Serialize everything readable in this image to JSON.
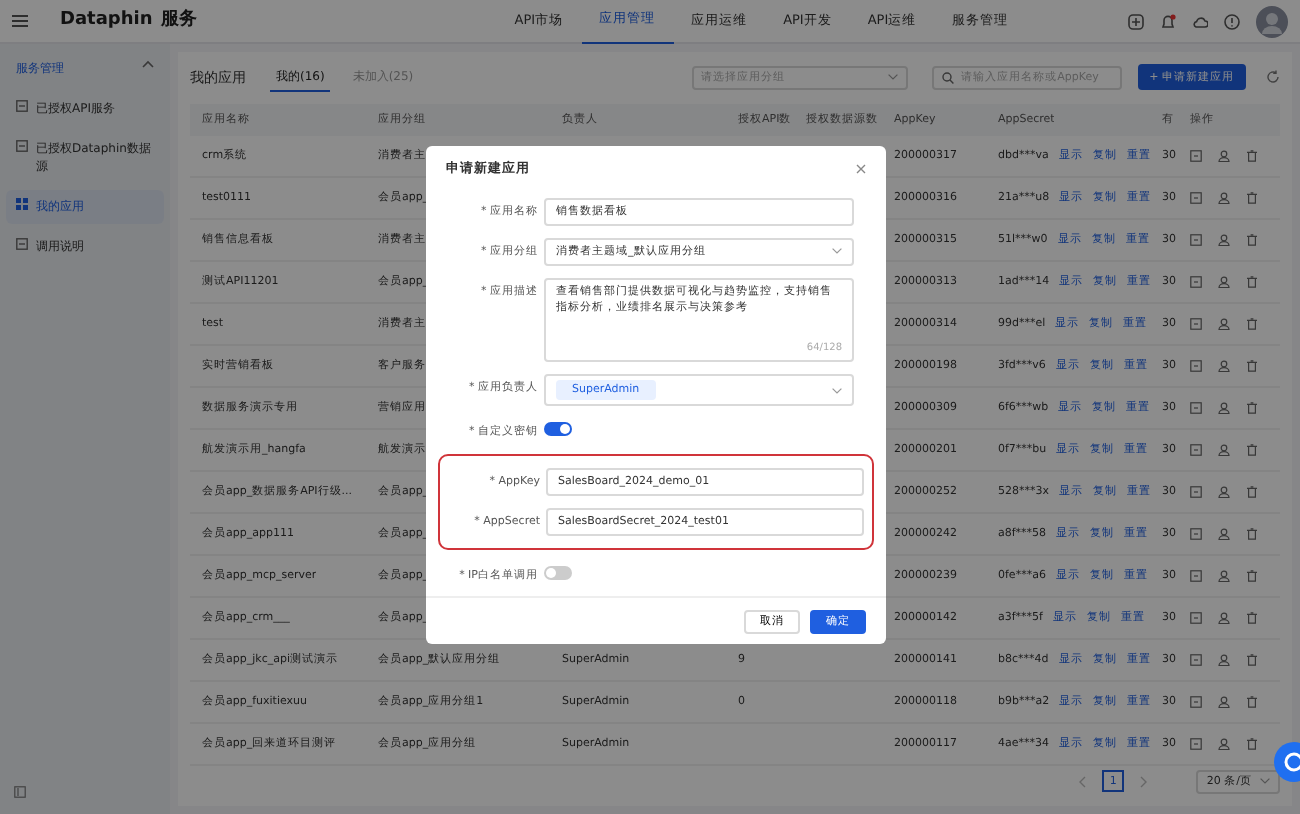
{
  "topbar": {
    "brand": "Dataphin",
    "product": "服务",
    "nav": [
      {
        "label": "API市场",
        "selected": false
      },
      {
        "label": "应用管理",
        "selected": true
      },
      {
        "label": "应用运维",
        "selected": false
      },
      {
        "label": "API开发",
        "selected": false
      },
      {
        "label": "API运维",
        "selected": false
      },
      {
        "label": "服务管理",
        "selected": false
      }
    ]
  },
  "sidebar": {
    "section": "服务管理",
    "expanded": true,
    "items": [
      {
        "label": "已授权API服务",
        "selected": false
      },
      {
        "label": "已授权Dataphin数据源",
        "selected": false
      },
      {
        "label": "我的应用",
        "selected": true
      },
      {
        "label": "调用说明",
        "selected": false
      }
    ]
  },
  "header": {
    "title": "我的应用",
    "tabs": [
      {
        "label": "我的(16)",
        "selected": true
      },
      {
        "label": "未加入(25)",
        "selected": false
      }
    ],
    "group_select": {
      "placeholder": "请选择应用分组"
    },
    "search": {
      "placeholder": "请输入应用名称或AppKey"
    },
    "create_button": "+ 申请新建应用"
  },
  "table": {
    "columns": [
      "应用名称",
      "应用分组",
      "负责人",
      "授权API数",
      "授权数据源数",
      "AppKey",
      "AppSecret",
      "有",
      "操作"
    ],
    "rows": [
      {
        "name": "crm系统",
        "group": "消费者主",
        "appkey": "200000317",
        "appsecret": "dbd***va",
        "column_8": "30",
        "links": [
          "显示",
          "复制",
          "重置"
        ]
      },
      {
        "name": "test0111",
        "group": "会员app_",
        "appkey": "200000316",
        "appsecret": "21a***u8",
        "column_8": "30",
        "links": [
          "显示",
          "复制",
          "重置"
        ]
      },
      {
        "name": "销售信息看板",
        "group": "消费者主",
        "appkey": "200000315",
        "appsecret": "51l***w0",
        "column_8": "30",
        "links": [
          "显示",
          "复制",
          "重置"
        ]
      },
      {
        "name": "测试API11201",
        "group": "会员app_",
        "appkey": "200000313",
        "appsecret": "1ad***14",
        "column_8": "30",
        "links": [
          "显示",
          "复制",
          "重置"
        ]
      },
      {
        "name": "test",
        "group": "消费者主",
        "appkey": "200000314",
        "appsecret": "99d***el",
        "column_8": "30",
        "links": [
          "显示",
          "复制",
          "重置"
        ]
      },
      {
        "name": "实时营销看板",
        "group": "客户服务",
        "appkey": "200000198",
        "appsecret": "3fd***v6",
        "column_8": "30",
        "links": [
          "显示",
          "复制",
          "重置"
        ]
      },
      {
        "name": "数据服务演示专用",
        "group": "营销应用",
        "appkey": "200000309",
        "appsecret": "6f6***wb",
        "column_8": "30",
        "links": [
          "显示",
          "复制",
          "重置"
        ]
      },
      {
        "name": "航发演示用_hangfa",
        "group": "航发演示",
        "appkey": "200000201",
        "appsecret": "0f7***bu",
        "column_8": "30",
        "links": [
          "显示",
          "复制",
          "重置"
        ]
      },
      {
        "name": "会员app_数据服务API行级...",
        "group": "会员app_",
        "appkey": "200000252",
        "appsecret": "528***3x",
        "column_8": "30",
        "links": [
          "显示",
          "复制",
          "重置"
        ]
      },
      {
        "name": "会员app_app111",
        "group": "会员app_",
        "appkey": "200000242",
        "appsecret": "a8f***58",
        "column_8": "30",
        "links": [
          "显示",
          "复制",
          "重置"
        ]
      },
      {
        "name": "会员app_mcp_server",
        "group": "会员app_",
        "appkey": "200000239",
        "appsecret": "0fe***a6",
        "column_8": "30",
        "links": [
          "显示",
          "复制",
          "重置"
        ]
      },
      {
        "name": "会员app_crm___",
        "group": "会员app_",
        "appkey": "200000142",
        "appsecret": "a3f***5f",
        "column_8": "30",
        "links": [
          "显示",
          "复制",
          "重置"
        ]
      },
      {
        "name": "会员app_jkc_api测试演示",
        "group": "会员app_默认应用分组",
        "owner": "SuperAdmin",
        "api_count": "9",
        "appkey": "200000141",
        "appsecret": "b8c***4d",
        "column_8": "30",
        "links": [
          "显示",
          "复制",
          "重置"
        ]
      },
      {
        "name": "会员app_fuxitiexuu",
        "group": "会员app_应用分组1",
        "owner": "SuperAdmin",
        "api_count": "0",
        "appkey": "200000118",
        "appsecret": "b9b***a2",
        "column_8": "30",
        "links": [
          "显示",
          "复制",
          "重置"
        ]
      },
      {
        "name": "会员app_回来道环目测评",
        "group": "会员app_应用分组",
        "owner": "SuperAdmin",
        "appkey": "200000117",
        "appsecret": "4ae***34",
        "column_8": "30",
        "links": [
          "显示",
          "复制",
          "重置"
        ]
      }
    ]
  },
  "pagination": {
    "pages": [
      {
        "label": "1",
        "selected": true
      }
    ],
    "page_size": "20 条/页"
  },
  "modal": {
    "title": "申请新建应用",
    "fields": [
      {
        "kind": "input",
        "label": "* 应用名称",
        "value": "销售数据看板"
      },
      {
        "kind": "select",
        "label": "* 应用分组",
        "value": "消费者主题域_默认应用分组"
      },
      {
        "kind": "textarea",
        "label": "* 应用描述",
        "value": "查看销售部门提供数据可视化与趋势监控，支持销售指标分析，业绩排名展示与决策参考",
        "counter": "64/128"
      },
      {
        "kind": "tags",
        "label": "* 应用负责人",
        "tags": [
          "SuperAdmin"
        ]
      },
      {
        "kind": "switch",
        "label": "* 自定义密钥",
        "on": true
      },
      {
        "kind": "input",
        "label": "* AppKey",
        "value": "SalesBoard_2024_demo_01",
        "highlighted": true
      },
      {
        "kind": "input",
        "label": "* AppSecret",
        "value": "SalesBoardSecret_2024_test01",
        "highlighted": true
      },
      {
        "kind": "switch",
        "label": "* IP白名单调用",
        "on": false
      }
    ],
    "buttons": [
      "取消",
      "确定"
    ]
  }
}
